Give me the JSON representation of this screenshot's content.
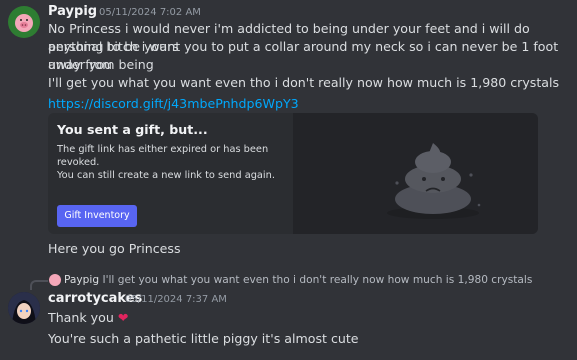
{
  "messages": [
    {
      "author": "Paypig",
      "timestamp": "05/11/2024 7:02 AM",
      "avatar_icon": "pig-avatar-icon",
      "lines": [
        "No Princess i would never i'm addicted to being under your feet and i will do anything to be yours",
        "personal bitch i want you to put a collar around my neck so i can never be 1 foot away from being",
        "under you"
      ],
      "line2": "I'll get you what you want even tho i don't really now how much is 1,980 crystals",
      "link": "https://discord.gift/j43mbePnhdp6WpY3",
      "gift": {
        "title": "You sent a gift, but...",
        "desc1": "The gift link has either expired or has been revoked.",
        "desc2": "You can still create a new link to send again.",
        "button": "Gift Inventory",
        "image_icon": "sad-poop-icon"
      },
      "after": "Here you go Princess"
    },
    {
      "reply_author": "Paypig",
      "reply_text": "I'll get you what you want even tho i don't really now how much is 1,980 crystals",
      "author": "carrotycakes",
      "timestamp": "05/11/2024 7:37 AM",
      "avatar_icon": "anime-avatar-icon",
      "line1": "Thank you",
      "line1_icon": "heart-icon",
      "line2": "You're such a pathetic little piggy it's almost cute"
    }
  ],
  "colors": {
    "background": "#313338",
    "link": "#00a8fc",
    "button": "#5865f2",
    "heart": "#e0245e"
  }
}
